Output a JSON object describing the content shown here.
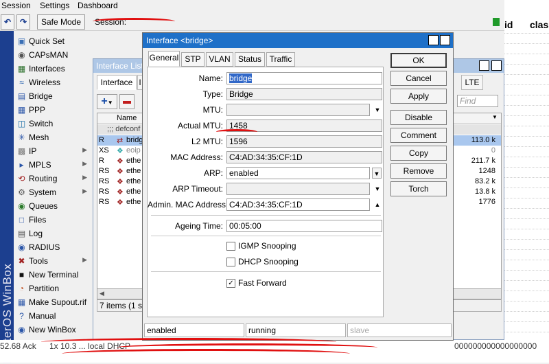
{
  "menubar": {
    "items": [
      "Session",
      "Settings",
      "Dashboard"
    ]
  },
  "toolbar": {
    "undo_icon": "undo-icon",
    "redo_icon": "redo-icon",
    "safe_mode": "Safe Mode",
    "session_label": "Session:"
  },
  "right_table": {
    "col1": "id",
    "col2": "clas",
    "bottom_value": "000000000000000000"
  },
  "sidebar": {
    "brand": "RouterOS WinBox",
    "items": [
      {
        "label": "Quick Set",
        "icon": "quick-set-icon",
        "submenu": false
      },
      {
        "label": "CAPsMAN",
        "icon": "capsman-icon",
        "submenu": false
      },
      {
        "label": "Interfaces",
        "icon": "interfaces-icon",
        "submenu": false
      },
      {
        "label": "Wireless",
        "icon": "wireless-icon",
        "submenu": false
      },
      {
        "label": "Bridge",
        "icon": "bridge-icon",
        "submenu": false
      },
      {
        "label": "PPP",
        "icon": "ppp-icon",
        "submenu": false
      },
      {
        "label": "Switch",
        "icon": "switch-icon",
        "submenu": false
      },
      {
        "label": "Mesh",
        "icon": "mesh-icon",
        "submenu": false
      },
      {
        "label": "IP",
        "icon": "ip-icon",
        "submenu": true
      },
      {
        "label": "MPLS",
        "icon": "mpls-icon",
        "submenu": true
      },
      {
        "label": "Routing",
        "icon": "routing-icon",
        "submenu": true
      },
      {
        "label": "System",
        "icon": "system-icon",
        "submenu": true
      },
      {
        "label": "Queues",
        "icon": "queues-icon",
        "submenu": false
      },
      {
        "label": "Files",
        "icon": "files-icon",
        "submenu": false
      },
      {
        "label": "Log",
        "icon": "log-icon",
        "submenu": false
      },
      {
        "label": "RADIUS",
        "icon": "radius-icon",
        "submenu": false
      },
      {
        "label": "Tools",
        "icon": "tools-icon",
        "submenu": true
      },
      {
        "label": "New Terminal",
        "icon": "terminal-icon",
        "submenu": false
      },
      {
        "label": "Partition",
        "icon": "partition-icon",
        "submenu": false
      },
      {
        "label": "Make Supout.rif",
        "icon": "supout-icon",
        "submenu": false
      },
      {
        "label": "Manual",
        "icon": "manual-icon",
        "submenu": false
      },
      {
        "label": "New WinBox",
        "icon": "winbox-icon",
        "submenu": false
      }
    ]
  },
  "iflist": {
    "title": "Interface List",
    "tab_interface": "Interface",
    "tab_partial": "I",
    "tab_lte": "LTE",
    "find_placeholder": "Find",
    "col_name": "Name",
    "group": ";;; defconf",
    "rows": [
      {
        "flag": "R",
        "name": "bridg",
        "value": "113.0 k",
        "selected": true
      },
      {
        "flag": "XS",
        "name": "eoip",
        "value": "0",
        "disabled": true
      },
      {
        "flag": "R",
        "name": "ethe",
        "value": "211.7 k"
      },
      {
        "flag": "RS",
        "name": "ethe",
        "value": "1248"
      },
      {
        "flag": "RS",
        "name": "ethe",
        "value": "83.2 k"
      },
      {
        "flag": "RS",
        "name": "ethe",
        "value": "13.8 k"
      },
      {
        "flag": "RS",
        "name": "ethe",
        "value": "1776"
      }
    ],
    "status": "7 items (1 sele"
  },
  "bottom": {
    "left_text": "52.68 Ack",
    "mid_text": "1x 10.3 ... local DHCP"
  },
  "dialog": {
    "title": "Interface <bridge>",
    "tabs": [
      "General",
      "STP",
      "VLAN",
      "Status",
      "Traffic"
    ],
    "fields": {
      "name_label": "Name:",
      "name_value": "bridge",
      "type_label": "Type:",
      "type_value": "Bridge",
      "mtu_label": "MTU:",
      "mtu_value": "",
      "actual_mtu_label": "Actual MTU:",
      "actual_mtu_value": "1458",
      "l2mtu_label": "L2 MTU:",
      "l2mtu_value": "1596",
      "mac_label": "MAC Address:",
      "mac_value": "C4:AD:34:35:CF:1D",
      "arp_label": "ARP:",
      "arp_value": "enabled",
      "arp_timeout_label": "ARP Timeout:",
      "arp_timeout_value": "",
      "admin_mac_label": "Admin. MAC Address:",
      "admin_mac_value": "C4:AD:34:35:CF:1D",
      "ageing_label": "Ageing Time:",
      "ageing_value": "00:05:00"
    },
    "checks": {
      "igmp": {
        "label": "IGMP Snooping",
        "checked": false
      },
      "dhcp": {
        "label": "DHCP Snooping",
        "checked": false
      },
      "fastfwd": {
        "label": "Fast Forward",
        "checked": true
      }
    },
    "buttons": [
      "OK",
      "Cancel",
      "Apply",
      "Disable",
      "Comment",
      "Copy",
      "Remove",
      "Torch"
    ],
    "status": [
      "enabled",
      "running",
      "slave"
    ]
  }
}
